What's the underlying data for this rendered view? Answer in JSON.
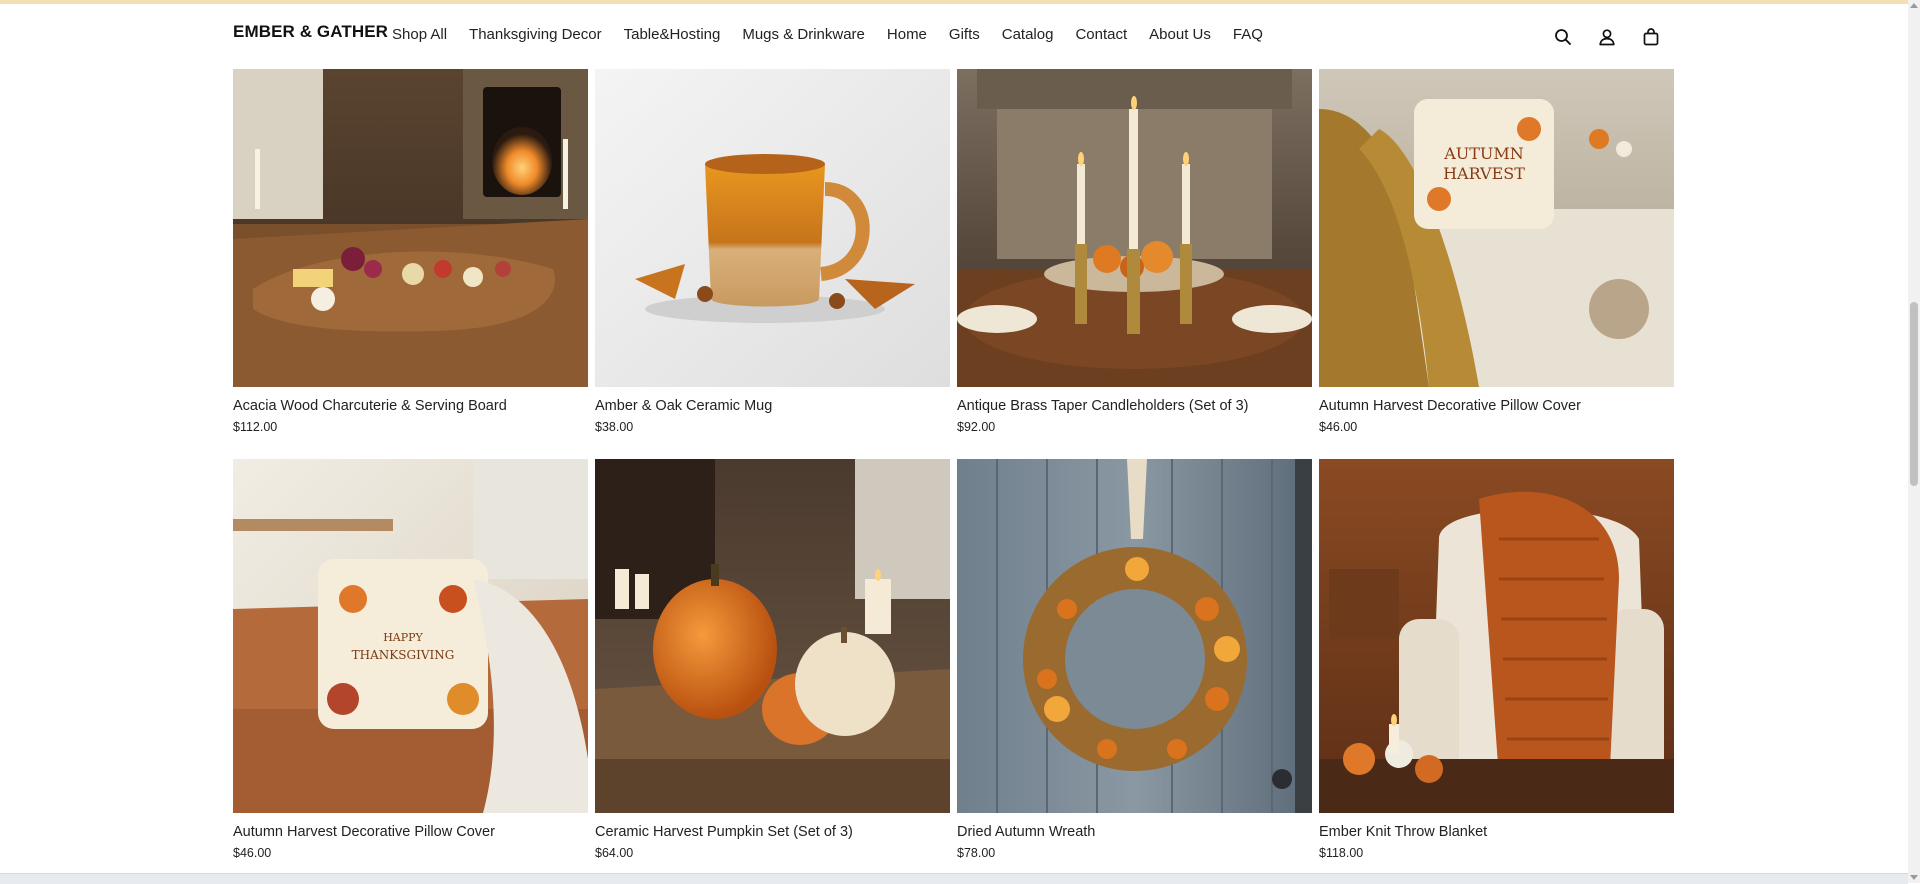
{
  "header": {
    "brand": "EMBER & GATHER",
    "nav": [
      {
        "label": "Shop All"
      },
      {
        "label": "Thanksgiving Decor"
      },
      {
        "label": "Table&Hosting"
      },
      {
        "label": "Mugs & Drinkware"
      },
      {
        "label": "Home"
      },
      {
        "label": "Gifts"
      },
      {
        "label": "Catalog"
      },
      {
        "label": "Contact"
      },
      {
        "label": "About Us"
      },
      {
        "label": "FAQ"
      }
    ],
    "icons": [
      "search-icon",
      "account-icon",
      "cart-icon"
    ]
  },
  "products": [
    {
      "title": "Acacia Wood Charcuterie & Serving Board",
      "price": "$112.00",
      "image": "charcuterie-board-photo"
    },
    {
      "title": "Amber & Oak Ceramic Mug",
      "price": "$38.00",
      "image": "ceramic-mug-photo"
    },
    {
      "title": "Antique Brass Taper Candleholders (Set of 3)",
      "price": "$92.00",
      "image": "brass-candleholders-photo"
    },
    {
      "title": "Autumn Harvest Decorative Pillow Cover",
      "price": "$46.00",
      "image": "autumn-pillow-photo",
      "image_text": "AUTUMN HARVEST"
    },
    {
      "title": "Autumn Harvest Decorative Pillow Cover",
      "price": "$46.00",
      "image": "thanksgiving-pillow-photo",
      "image_text": "HAPPY THANKSGIVING"
    },
    {
      "title": "Ceramic Harvest Pumpkin Set (Set of 3)",
      "price": "$64.00",
      "image": "ceramic-pumpkins-photo"
    },
    {
      "title": "Dried Autumn Wreath",
      "price": "$78.00",
      "image": "autumn-wreath-photo"
    },
    {
      "title": "Ember Knit Throw Blanket",
      "price": "$118.00",
      "image": "knit-throw-photo"
    }
  ],
  "colors": {
    "accent_strip": "#f3dfb4",
    "text": "#222222"
  }
}
